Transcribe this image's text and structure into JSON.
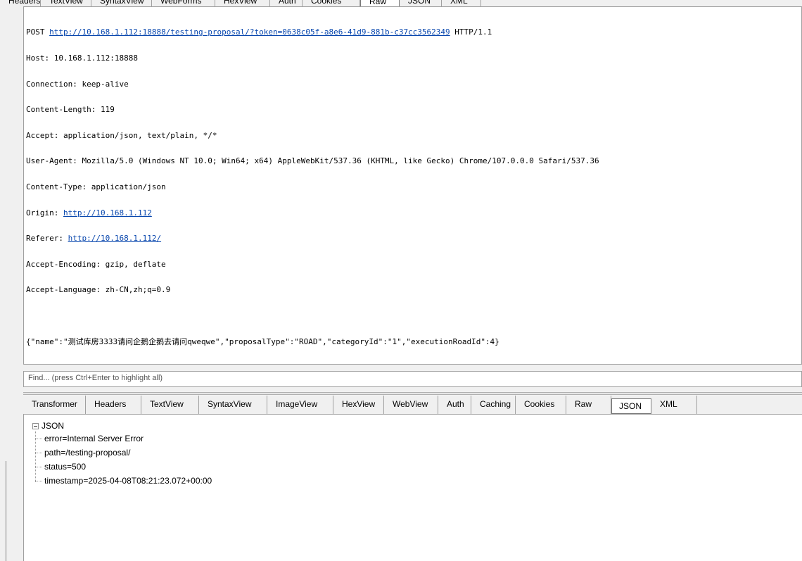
{
  "request": {
    "tabs": [
      "Headers",
      "TextView",
      "SyntaxView",
      "WebForms",
      "HexView",
      "Auth",
      "Cookies",
      "Raw",
      "JSON",
      "XML"
    ],
    "active_tab": "Raw",
    "raw": {
      "request_method": "POST",
      "request_url": "http://10.168.1.112:18888/testing-proposal/?token=0638c05f-a8e6-41d9-881b-c37cc3562349",
      "request_protocol": "HTTP/1.1",
      "host": "Host: 10.168.1.112:18888",
      "connection": "Connection: keep-alive",
      "content_length": "Content-Length: 119",
      "accept": "Accept: application/json, text/plain, */*",
      "user_agent": "User-Agent: Mozilla/5.0 (Windows NT 10.0; Win64; x64) AppleWebKit/537.36 (KHTML, like Gecko) Chrome/107.0.0.0 Safari/537.36",
      "content_type": "Content-Type: application/json",
      "origin_label": "Origin: ",
      "origin_url": "http://10.168.1.112",
      "referer_label": "Referer: ",
      "referer_url": "http://10.168.1.112/",
      "accept_encoding": "Accept-Encoding: gzip, deflate",
      "accept_language": "Accept-Language: zh-CN,zh;q=0.9",
      "body": "{\"name\":\"测试库房3333请问企鹅企鹅去请问qweqwe\",\"proposalType\":\"ROAD\",\"categoryId\":\"1\",\"executionRoadId\":4}"
    },
    "find_placeholder": "Find... (press Ctrl+Enter to highlight all)"
  },
  "response": {
    "tabs": [
      "Transformer",
      "Headers",
      "TextView",
      "SyntaxView",
      "ImageView",
      "HexView",
      "WebView",
      "Auth",
      "Caching",
      "Cookies",
      "Raw",
      "JSON",
      "XML"
    ],
    "active_tab": "JSON",
    "tree": {
      "root": "JSON",
      "children": [
        "error=Internal Server Error",
        "path=/testing-proposal/",
        "status=500",
        "timestamp=2025-04-08T08:21:23.072+00:00"
      ]
    }
  },
  "colors": {
    "link": "#0645ad",
    "panel": "#f0f0f0",
    "border": "#a0a0a0"
  }
}
